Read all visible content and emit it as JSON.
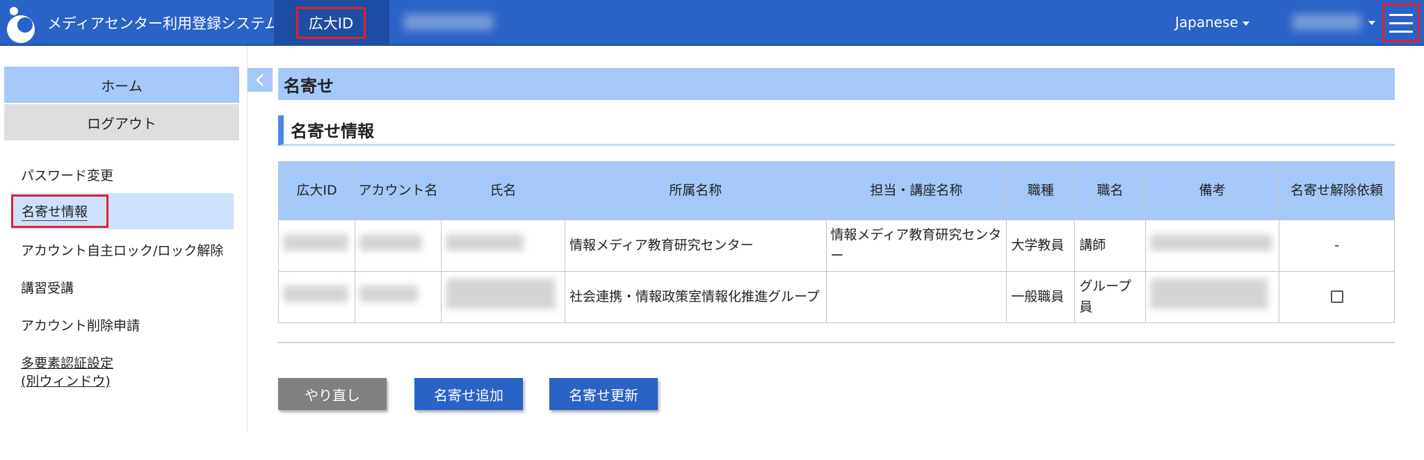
{
  "header": {
    "app_title": "メディアセンター利用登録システム",
    "id_tab": "広大ID",
    "language": "Japanese"
  },
  "sidebar": {
    "home": "ホーム",
    "logout": "ログアウト",
    "items": [
      {
        "label": "パスワード変更"
      },
      {
        "label": "名寄せ情報"
      },
      {
        "label": "アカウント自主ロック/ロック解除"
      },
      {
        "label": "講習受講"
      },
      {
        "label": "アカウント削除申請"
      },
      {
        "label": "多要素認証設定"
      },
      {
        "label": "(別ウィンドウ)"
      }
    ]
  },
  "main": {
    "page_heading": "名寄せ",
    "section_title": "名寄せ情報",
    "table": {
      "headers": [
        "広大ID",
        "アカウント名",
        "氏名",
        "所属名称",
        "担当・講座名称",
        "職種",
        "職名",
        "備考",
        "名寄せ解除依頼"
      ],
      "rows": [
        {
          "affiliation": "情報メディア教育研究センター",
          "department": "情報メディア教育研究センター",
          "job_type": "大学教員",
          "title": "講師",
          "release": "-"
        },
        {
          "affiliation": "社会連携・情報政策室情報化推進グループ",
          "department": "",
          "job_type": "一般職員",
          "title": "グループ員",
          "release": ""
        }
      ]
    },
    "buttons": {
      "reset": "やり直し",
      "add": "名寄せ追加",
      "update": "名寄せ更新"
    }
  },
  "colors": {
    "header_bg": "#2a63c6",
    "accent_light": "#a4c8f8",
    "highlight_box": "#e0202e"
  }
}
